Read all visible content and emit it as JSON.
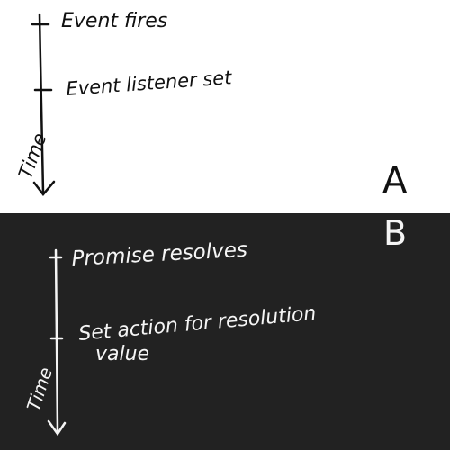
{
  "panel_a": {
    "label": "A",
    "axis_label": "Time",
    "events": [
      "Event fires",
      "Event listener set"
    ]
  },
  "panel_b": {
    "label": "B",
    "axis_label": "Time",
    "events": [
      "Promise resolves",
      "Set action for resolution",
      "value"
    ]
  },
  "colors": {
    "panel_a_bg": "#ffffff",
    "panel_b_bg": "#222222",
    "ink_dark": "#111111",
    "ink_light": "#f5f5f5"
  }
}
